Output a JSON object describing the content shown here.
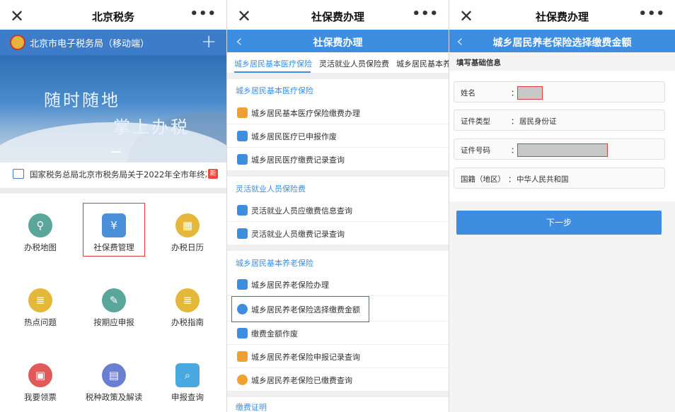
{
  "panel1": {
    "topbar": {
      "close_icon": "✕",
      "title": "北京税务",
      "more": "•••"
    },
    "header": {
      "name": "北京市电子税务局（移动端）",
      "plus": "+"
    },
    "banner": {
      "line1": "随时随地",
      "line2": "掌上办税"
    },
    "notice": {
      "text": "国家税务总局北京市税务局关于2022年全市年终决…",
      "badge": "新"
    },
    "grid": [
      {
        "label": "办税地图",
        "color": "#5aa69a",
        "glyph": "⚲"
      },
      {
        "label": "社保费管理",
        "color": "#4a8fd8",
        "glyph": "¥"
      },
      {
        "label": "办税日历",
        "color": "#e5b83a",
        "glyph": "▦"
      },
      {
        "label": "热点问题",
        "color": "#e5b83a",
        "glyph": "≣"
      },
      {
        "label": "按期应申报",
        "color": "#5aa69a",
        "glyph": "✎"
      },
      {
        "label": "办税指南",
        "color": "#e5b83a",
        "glyph": "≣"
      },
      {
        "label": "我要领票",
        "color": "#e05a5a",
        "glyph": "▣"
      },
      {
        "label": "税种政策及解读",
        "color": "#6a7fd0",
        "glyph": "▤"
      },
      {
        "label": "申报查询",
        "color": "#4aa8e0",
        "glyph": "⌕"
      }
    ]
  },
  "panel2": {
    "topbar": {
      "close_icon": "✕",
      "title": "社保费办理",
      "more": "•••"
    },
    "bluebar": {
      "back": "‹",
      "title": "社保费办理"
    },
    "tabs": [
      "城乡居民基本医疗保险",
      "灵活就业人员保险费",
      "城乡居民基本养"
    ],
    "sections": [
      {
        "title": "城乡居民基本医疗保险",
        "items": [
          {
            "label": "城乡居民基本医疗保险缴费办理",
            "color": "#f0a030"
          },
          {
            "label": "城乡居民医疗已申报作废",
            "color": "#3d8ee0"
          },
          {
            "label": "城乡居民医疗缴费记录查询",
            "color": "#3d8ee0"
          }
        ]
      },
      {
        "title": "灵活就业人员保险费",
        "items": [
          {
            "label": "灵活就业人员应缴费信息查询",
            "color": "#3d8ee0"
          },
          {
            "label": "灵活就业人员缴费记录查询",
            "color": "#3d8ee0"
          }
        ]
      },
      {
        "title": "城乡居民基本养老保险",
        "items": [
          {
            "label": "城乡居民养老保险办理",
            "color": "#3d8ee0"
          },
          {
            "label": "城乡居民养老保险选择缴费金额",
            "color": "#3d8ee0"
          },
          {
            "label": "缴费金额作废",
            "color": "#3d8ee0"
          },
          {
            "label": "城乡居民养老保险申报记录查询",
            "color": "#f0a030"
          },
          {
            "label": "城乡居民养老保险已缴费查询",
            "color": "#f0a030"
          }
        ]
      }
    ],
    "footer_section": "缴费证明"
  },
  "panel3": {
    "topbar": {
      "close_icon": "✕",
      "title": "社保费办理",
      "more": "•••"
    },
    "bluebar": {
      "back": "‹",
      "title": "城乡居民养老保险选择缴费金额"
    },
    "fill_header": "填写基础信息",
    "fields": [
      {
        "label": "姓名",
        "colon": "：",
        "value": ""
      },
      {
        "label": "证件类型",
        "colon": "：",
        "value": "居民身份证"
      },
      {
        "label": "证件号码",
        "colon": "：",
        "value": ""
      },
      {
        "label": "国籍（地区）",
        "colon": "：",
        "value": "中华人民共和国"
      }
    ],
    "next_button": "下一步"
  }
}
